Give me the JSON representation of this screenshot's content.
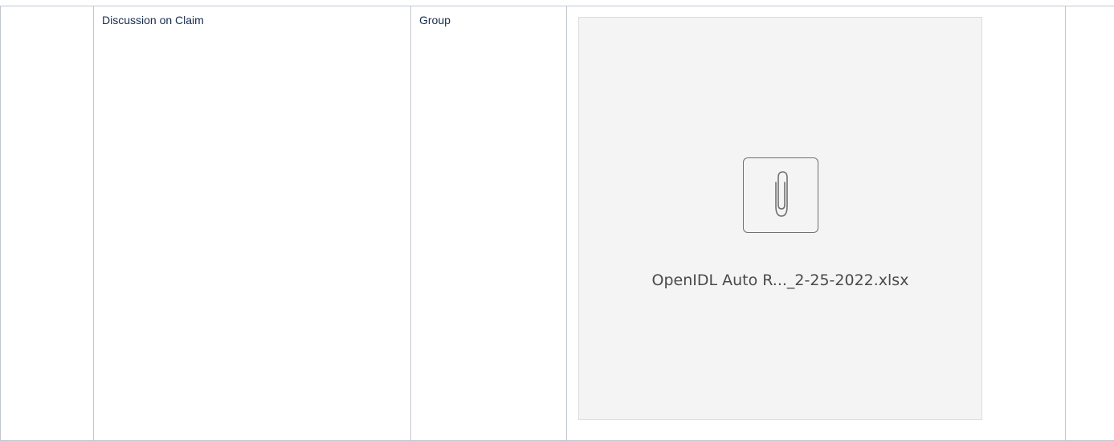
{
  "table": {
    "row": {
      "topic": "Discussion on Claim",
      "owner": "Group"
    }
  },
  "attachment": {
    "icon": "paperclip-icon",
    "file_name": "OpenIDL Auto R..._2-25-2022.xlsx"
  },
  "colors": {
    "border": "#c1c7d0",
    "card_background": "#f4f4f4",
    "text": "#172b4d"
  }
}
